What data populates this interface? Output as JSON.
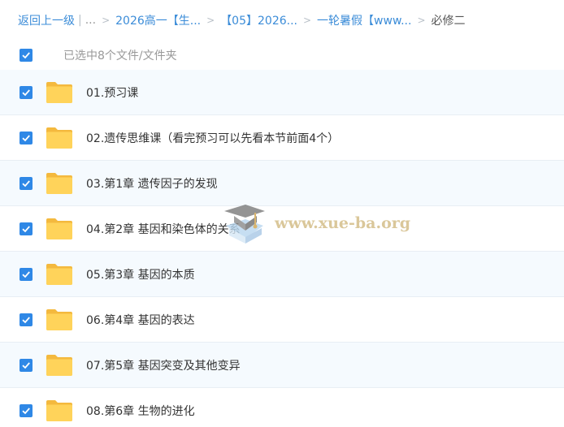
{
  "breadcrumb": {
    "back": "返回上一级",
    "bar": "|",
    "ellipsis": "...",
    "sep": ">",
    "crumbs": [
      "2026高一【生...",
      "【05】2026...",
      "一轮暑假【www..."
    ],
    "current": "必修二"
  },
  "selection": {
    "label": "已选中8个文件/文件夹"
  },
  "files": [
    {
      "name": "01.预习课"
    },
    {
      "name": "02.遗传思维课（看完预习可以先看本节前面4个）"
    },
    {
      "name": "03.第1章 遗传因子的发现"
    },
    {
      "name": "04.第2章 基因和染色体的关系"
    },
    {
      "name": "05.第3章 基因的本质"
    },
    {
      "name": "06.第4章 基因的表达"
    },
    {
      "name": "07.第5章 基因突变及其他变异"
    },
    {
      "name": "08.第6章 生物的进化"
    }
  ],
  "watermark": {
    "text": "www.xue-ba.org",
    "icon": "graduation-cap-icon"
  },
  "colors": {
    "accent": "#2f88e6",
    "link": "#3b8cd8",
    "folder": "#ffd35a",
    "row_alt": "#f5fafe"
  }
}
